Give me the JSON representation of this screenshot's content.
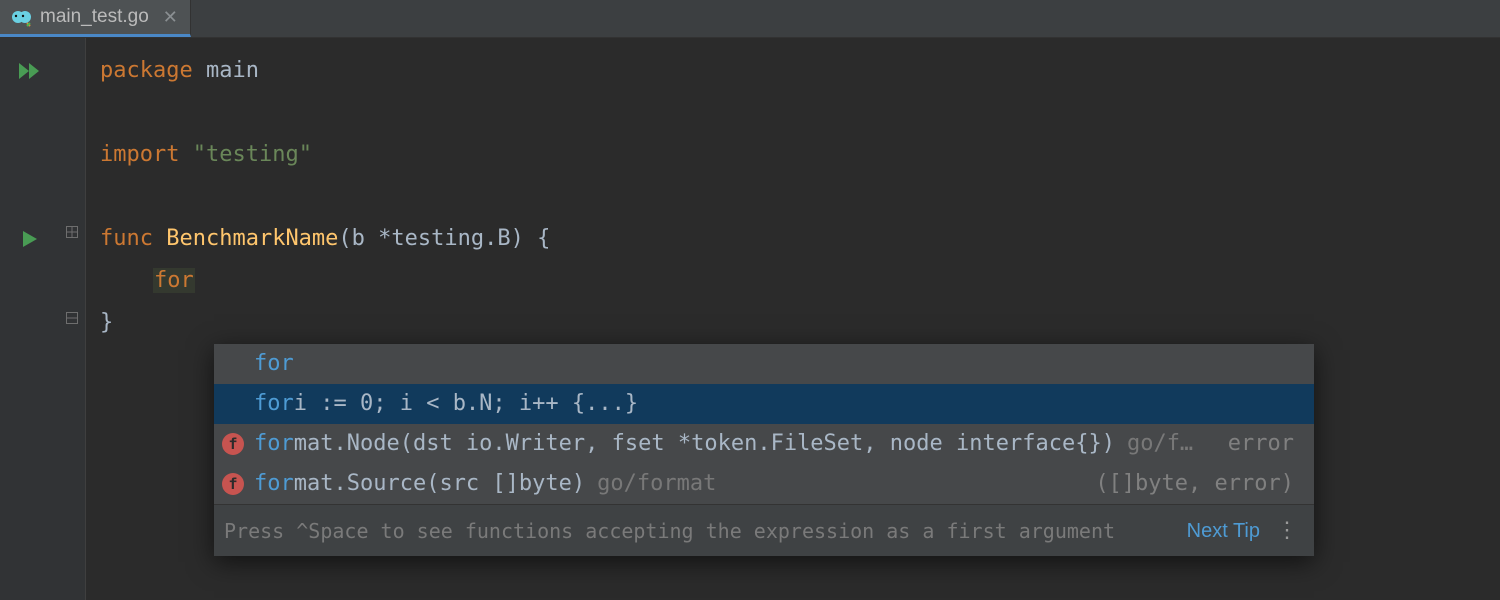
{
  "tab": {
    "filename": "main_test.go"
  },
  "code": {
    "line1_kw": "package",
    "line1_id": "main",
    "line3_kw": "import",
    "line3_str": "\"testing\"",
    "line5_kw": "func",
    "line5_name": "BenchmarkName",
    "line5_params_open": "(b *",
    "line5_params_pkg": "testing",
    "line5_params_close": ".B) {",
    "line6_typed": "for",
    "line7_brace": "}"
  },
  "completion": {
    "items": [
      {
        "kind": "kw",
        "match": "for",
        "rest": "",
        "tail": "",
        "rtype": ""
      },
      {
        "kind": "kw",
        "match": "for",
        "rest": " i := 0; i < b.N; i++ {...}",
        "tail": "",
        "rtype": ""
      },
      {
        "kind": "func",
        "match": "for",
        "rest": "mat.Node(dst io.Writer, fset *token.FileSet, node interface{})",
        "tail": "go/f…",
        "rtype": "error"
      },
      {
        "kind": "func",
        "match": "for",
        "rest": "mat.Source(src []byte)",
        "tail": "go/format",
        "rtype": "([]byte, error)"
      }
    ],
    "selected_index": 1,
    "footer_hint": "Press ^Space to see functions accepting the expression as a first argument",
    "footer_link": "Next Tip"
  }
}
